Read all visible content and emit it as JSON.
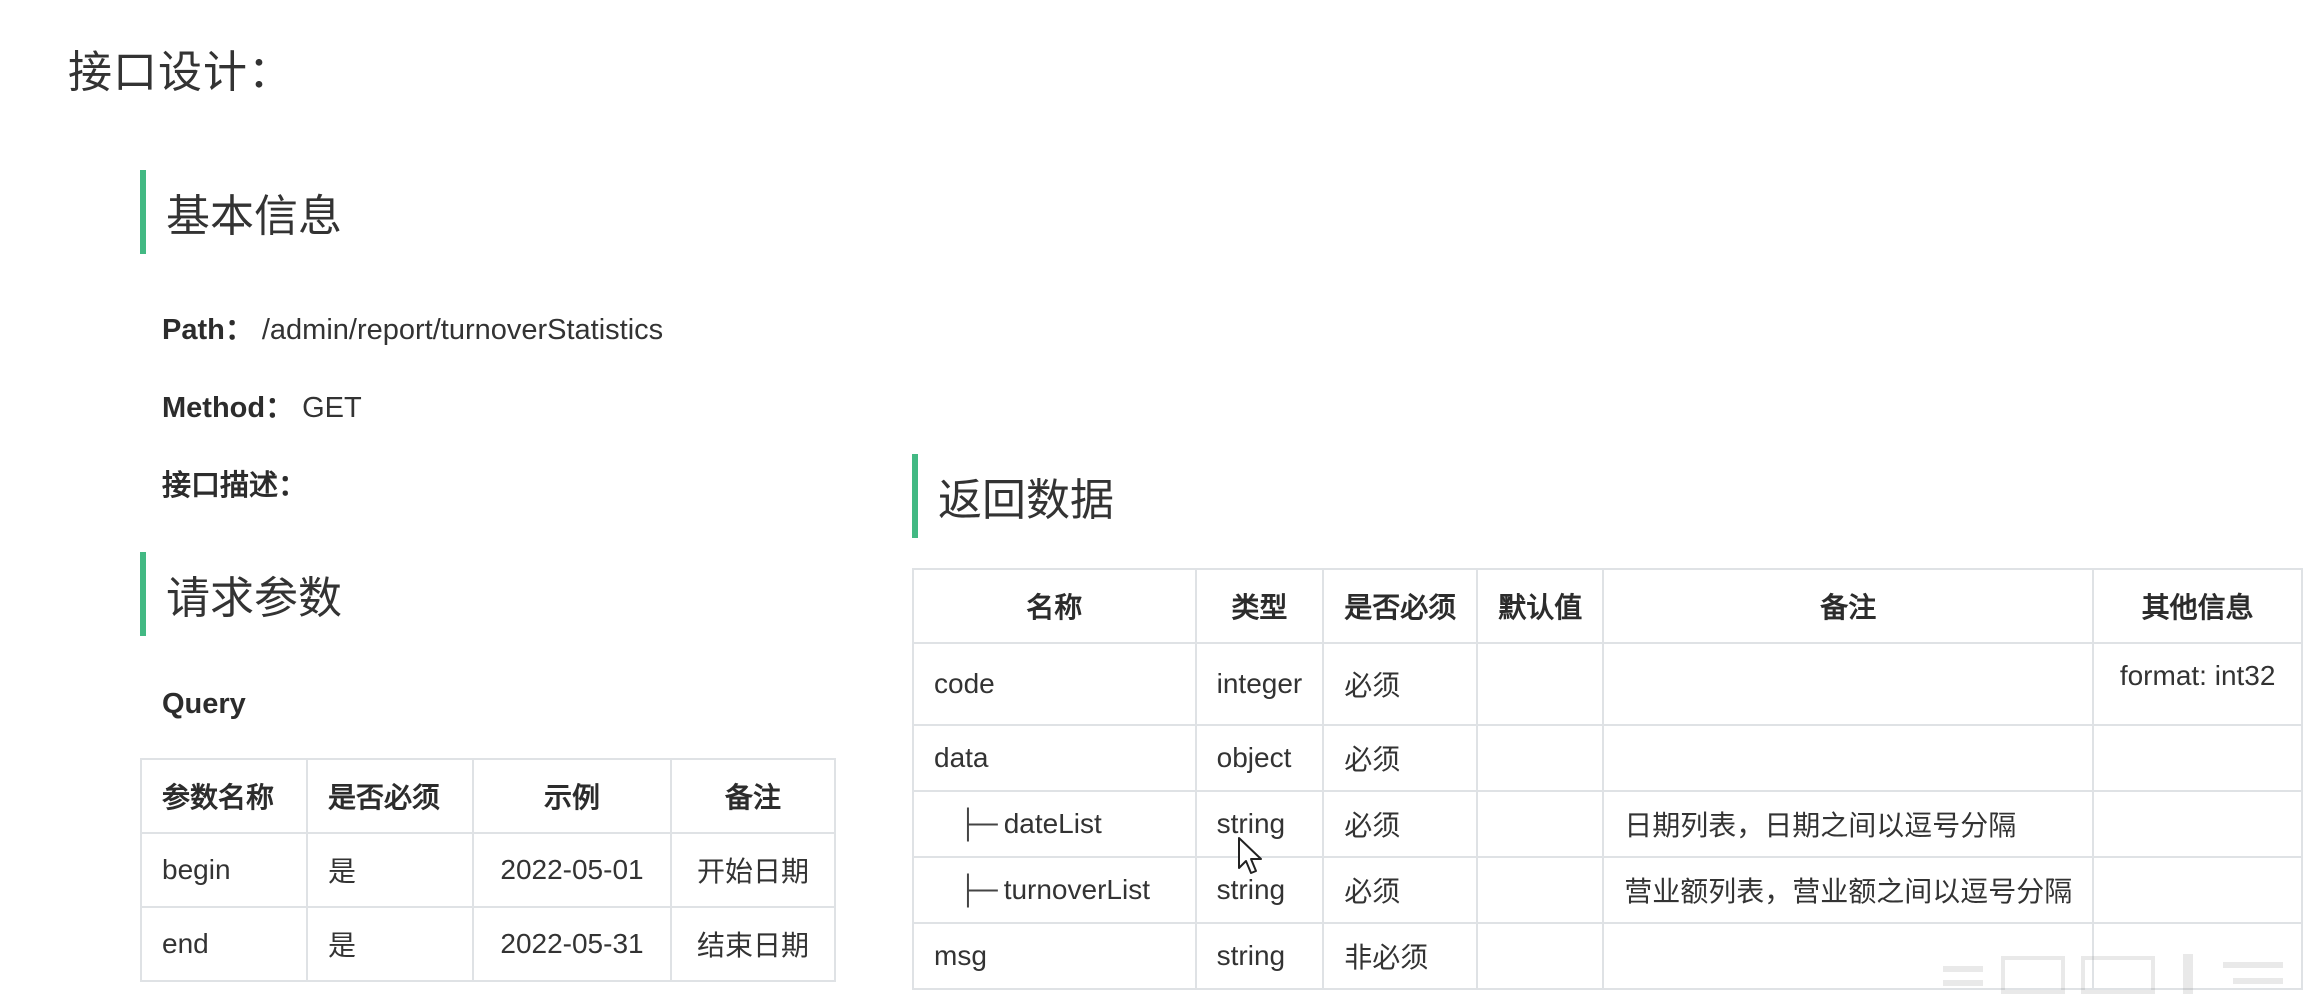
{
  "page_title": "接口设计：",
  "basic_info": {
    "heading": "基本信息",
    "path_label": "Path：",
    "path_value": "/admin/report/turnoverStatistics",
    "method_label": "Method：",
    "method_value": "GET",
    "desc_label": "接口描述："
  },
  "request": {
    "heading": "请求参数",
    "query_label": "Query",
    "headers": [
      "参数名称",
      "是否必须",
      "示例",
      "备注"
    ],
    "rows": [
      [
        "begin",
        "是",
        "2022-05-01",
        "开始日期"
      ],
      [
        "end",
        "是",
        "2022-05-31",
        "结束日期"
      ]
    ]
  },
  "response": {
    "heading": "返回数据",
    "headers": [
      "名称",
      "类型",
      "是否必须",
      "默认值",
      "备注",
      "其他信息"
    ],
    "tree_glyph": "├─",
    "rows": [
      {
        "name": "code",
        "type": "integer",
        "required": "必须",
        "default": "",
        "remark": "",
        "other": "format: int32"
      },
      {
        "name": "data",
        "type": "object",
        "required": "必须",
        "default": "",
        "remark": "",
        "other": ""
      },
      {
        "name": "dateList",
        "type": "string",
        "required": "必须",
        "default": "",
        "remark": "日期列表，日期之间以逗号分隔",
        "other": ""
      },
      {
        "name": "turnoverList",
        "type": "string",
        "required": "必须",
        "default": "",
        "remark": "营业额列表，营业额之间以逗号分隔",
        "other": ""
      },
      {
        "name": "msg",
        "type": "string",
        "required": "非必须",
        "default": "",
        "remark": "",
        "other": ""
      }
    ]
  },
  "accent_color": "#42b983"
}
